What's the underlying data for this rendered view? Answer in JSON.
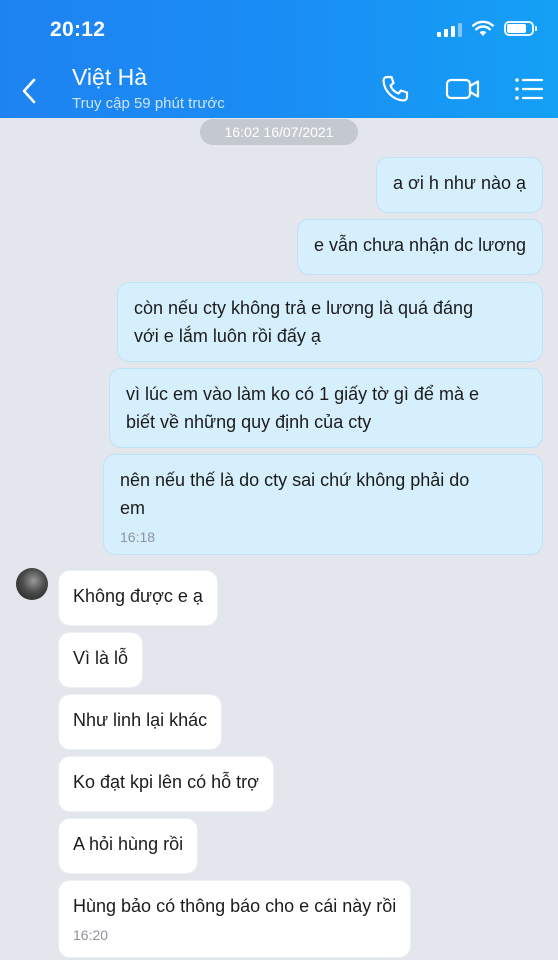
{
  "status_bar": {
    "time": "20:12",
    "battery_level": 0.8
  },
  "header": {
    "contact_name": "Việt Hà",
    "contact_status": "Truy cập 59 phút trước"
  },
  "date_separator": "16:02 16/07/2021",
  "outgoing_messages": [
    {
      "text": "a ơi h như nào ạ"
    },
    {
      "text": "e vẫn chưa nhận dc lương"
    },
    {
      "text": "còn nếu cty không trả e lương là quá đáng\nvới e lắm luôn rồi đấy ạ"
    },
    {
      "text": "vì lúc em vào làm ko có 1 giấy tờ gì để mà e\nbiết về những quy định của cty"
    },
    {
      "text": "nên nếu thế là do cty sai chứ không phải do\nem",
      "time": "16:18"
    }
  ],
  "incoming_messages": [
    {
      "text": "Không được e ạ"
    },
    {
      "text": "Vì là lỗ"
    },
    {
      "text": "Như linh lại khác"
    },
    {
      "text": "Ko đạt kpi lên có hỗ trợ"
    },
    {
      "text": "A hỏi hùng rồi"
    },
    {
      "text": "Hùng bảo có thông báo cho e cái này rồi",
      "time": "16:20"
    }
  ],
  "colors": {
    "header_blue": "#1a8df5",
    "outgoing_bubble": "#d6effc",
    "incoming_bubble": "#ffffff",
    "background": "#e3e6ec"
  }
}
